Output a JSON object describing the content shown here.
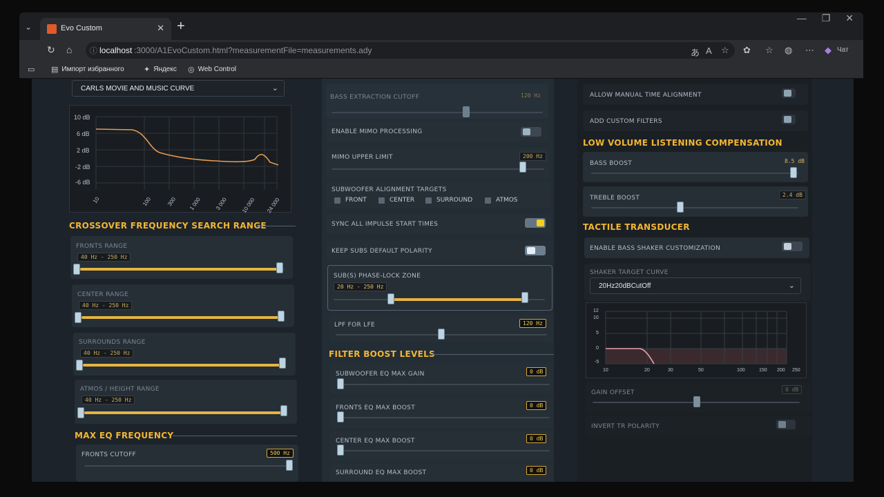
{
  "browser": {
    "tab_title": "Evo Custom",
    "url_host": "localhost",
    "url_path": ":3000/A1EvoCustom.html?measurementFile=measurements.ady",
    "copilot_label": "Чат",
    "bookmarks": [
      "Импорт избранного",
      "Яндекс",
      "Web Control"
    ]
  },
  "left": {
    "curve_select": "CARLS MOVIE AND MUSIC CURVE",
    "eq_chart": {
      "y_ticks": [
        "10 dB",
        "6 dB",
        "2 dB",
        "-2 dB",
        "-6 dB"
      ],
      "x_ticks": [
        "10",
        "100",
        "300",
        "1 000",
        "3 000",
        "10 000",
        "24 000"
      ]
    },
    "crossover_title": "CROSSOVER FREQUENCY SEARCH RANGE",
    "ranges": [
      {
        "label": "FRONTS RANGE",
        "value": "40 Hz - 250 Hz"
      },
      {
        "label": "CENTER RANGE",
        "value": "40 Hz - 250 Hz"
      },
      {
        "label": "SURROUNDS RANGE",
        "value": "40 Hz - 250 Hz"
      },
      {
        "label": "ATMOS / HEIGHT RANGE",
        "value": "40 Hz - 250 Hz"
      }
    ],
    "maxeq_title": "MAX EQ FREQUENCY",
    "fronts_cutoff_label": "FRONTS CUTOFF",
    "fronts_cutoff_value": "500 Hz"
  },
  "middle": {
    "bass_extraction_label": "BASS EXTRACTION CUTOFF",
    "bass_extraction_value": "120 Hz",
    "mimo_enable_label": "ENABLE MIMO PROCESSING",
    "mimo_upper_label": "MIMO UPPER LIMIT",
    "mimo_upper_value": "200 Hz",
    "sub_targets_label": "SUBWOOFER ALIGNMENT TARGETS",
    "sub_targets": [
      "FRONT",
      "CENTER",
      "SURROUND",
      "ATMOS"
    ],
    "sync_label": "SYNC ALL IMPULSE START TIMES",
    "keep_polarity_label": "KEEP SUBS DEFAULT POLARITY",
    "phase_lock_label": "SUB(S) PHASE-LOCK ZONE",
    "phase_lock_value": "20 Hz - 250 Hz",
    "lpf_label": "LPF FOR LFE",
    "lpf_value": "120 Hz",
    "filter_title": "FILTER BOOST LEVELS",
    "boosts": [
      {
        "label": "SUBWOOFER EQ MAX GAIN",
        "value": "0 dB"
      },
      {
        "label": "FRONTS EQ MAX BOOST",
        "value": "0 dB"
      },
      {
        "label": "CENTER EQ MAX BOOST",
        "value": "0 dB"
      },
      {
        "label": "SURROUND EQ MAX BOOST",
        "value": "0 dB"
      }
    ]
  },
  "right": {
    "manual_time_label": "ALLOW MANUAL TIME ALIGNMENT",
    "custom_filters_label": "ADD CUSTOM FILTERS",
    "lvlc_title": "LOW VOLUME LISTENING COMPENSATION",
    "bass_boost_label": "BASS BOOST",
    "bass_boost_value": "8.5 dB",
    "treble_boost_label": "TREBLE BOOST",
    "treble_boost_value": "2.4 dB",
    "tactile_title": "TACTILE TRANSDUCER",
    "shaker_enable_label": "ENABLE BASS SHAKER CUSTOMIZATION",
    "shaker_curve_label": "SHAKER TARGET CURVE",
    "shaker_curve_value": "20Hz20dBCutOff",
    "shaker_chart": {
      "y_ticks": [
        "12",
        "10",
        "5",
        "0",
        "-5"
      ],
      "x_ticks": [
        "10",
        "20",
        "30",
        "50",
        "100",
        "150",
        "200",
        "250"
      ]
    },
    "gain_offset_label": "GAIN OFFSET",
    "gain_offset_value": "0 dB",
    "invert_label": "INVERT TR POLARITY"
  }
}
